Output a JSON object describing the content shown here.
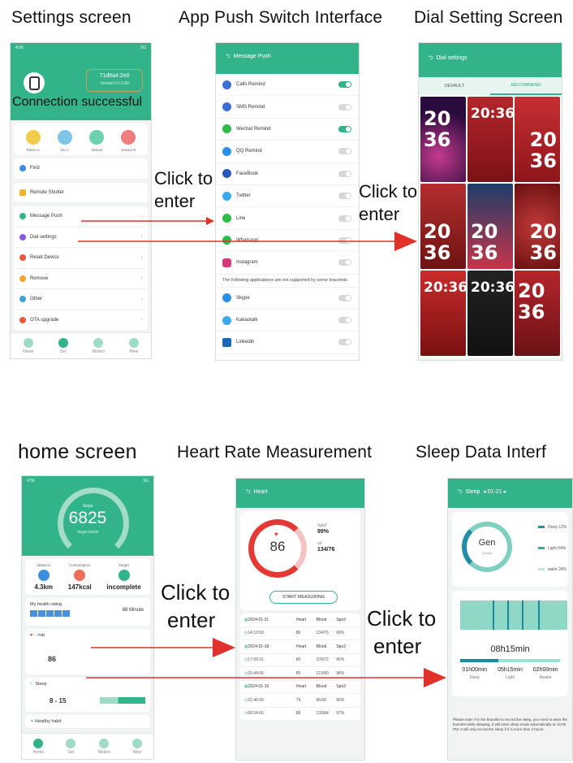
{
  "captions": {
    "settings": "Settings screen",
    "push": "App Push Switch Interface",
    "dial": "Dial Setting Screen",
    "home": "home screen",
    "heart": "Heart Rate Measurement",
    "sleep": "Sleep Data Interf"
  },
  "arrow_labels": {
    "a1_line1": "Click to",
    "a1_line2": "enter",
    "a2_line1": "Click to",
    "a2_line2": "enter",
    "a3_line1": "Click to",
    "a3_line2": "enter",
    "a4_line1": "Click to",
    "a4_line2": "enter"
  },
  "colors": {
    "brand": "#33b389",
    "arrow": "#e0312b",
    "highlight": "#c9a15a"
  },
  "settings_phone": {
    "device_id": "71d6a4:2e0",
    "device_version": "Version:V1.0.60",
    "connection": "Connection successful",
    "quick": [
      "Raise in",
      "Do n",
      "Alarms",
      "ientary R"
    ],
    "menu1": [
      {
        "label": "Find",
        "icon": "search-icon"
      }
    ],
    "menu2": [
      {
        "label": "Remote Shutter",
        "icon": "camera-icon"
      }
    ],
    "menu3": [
      {
        "label": "Message Push",
        "icon": "send-icon"
      },
      {
        "label": "Dial settings",
        "icon": "dial-icon"
      },
      {
        "label": "Reset Device",
        "icon": "reset-icon"
      },
      {
        "label": "Remove",
        "icon": "remove-icon"
      },
      {
        "label": "Other",
        "icon": "other-icon"
      },
      {
        "label": "OTA upgrade",
        "icon": "upgrade-icon"
      }
    ],
    "tabs": [
      "Home",
      "Set",
      "Motion",
      "Mine"
    ]
  },
  "push_phone": {
    "title": "Message Push",
    "items": [
      {
        "label": "Calls Remind",
        "on": true
      },
      {
        "label": "SMS Remind",
        "on": false
      },
      {
        "label": "Wechat Remind",
        "on": true
      },
      {
        "label": "QQ Remind",
        "on": false
      },
      {
        "label": "FaceBook",
        "on": false
      },
      {
        "label": "Twitter",
        "on": false
      },
      {
        "label": "Line",
        "on": false
      },
      {
        "label": "Whatsapp",
        "on": false
      },
      {
        "label": "Instagram",
        "on": false
      }
    ],
    "note": "The following applications are not supported by some bracelets",
    "extra": [
      {
        "label": "Skype",
        "on": false
      },
      {
        "label": "Kakaotalk",
        "on": false
      },
      {
        "label": "Linkedin",
        "on": false
      }
    ]
  },
  "dial_phone": {
    "title": "Dial settings",
    "tab_default": "DEFAULT",
    "tab_recommend": "RECOMMEND",
    "faces": [
      {
        "text": "20\n36"
      },
      {
        "text": "20:36"
      },
      {
        "text": "20\n36"
      },
      {
        "text": "20\n36"
      },
      {
        "text": "20\n36"
      },
      {
        "text": "20\n36"
      },
      {
        "text": "20:36"
      },
      {
        "text": "20:36"
      },
      {
        "text": "20\n36"
      }
    ]
  },
  "home_phone": {
    "steps_label": "Steps",
    "steps": "6825",
    "target": "Target:10000",
    "stats": [
      {
        "label": "distance",
        "value": "4.3km"
      },
      {
        "label": "Consumption",
        "value": "147kcal"
      },
      {
        "label": "Target",
        "value": "incomplete"
      }
    ],
    "rating_label": "My health rating",
    "rating_value": "88 Minute",
    "hr_label": "- -/rat",
    "hr_value": "86",
    "sleep_label": "Sleep",
    "sleep_value": "8 - 15",
    "habit": "Healthy habit",
    "tabs": [
      "Home",
      "Set",
      "Motion",
      "Mine"
    ]
  },
  "heart_phone": {
    "title": "Heart",
    "value": "86",
    "spo2_label": "Spo2",
    "spo2": "99%",
    "bp_label": "od",
    "bp": "134/76",
    "start": "START MEASURING",
    "rows": [
      {
        "a": "2024-01-21",
        "b": "Heart",
        "c": "Blood",
        "d": "Spo2",
        "date": true
      },
      {
        "a": "14:13:50",
        "b": "86",
        "c": "134/76",
        "d": "99%"
      },
      {
        "a": "2024-01-18",
        "b": "Heart",
        "c": "Blood",
        "d": "Spo2",
        "date": true
      },
      {
        "a": "17:09:31",
        "b": "80",
        "c": "109/72",
        "d": "96%"
      },
      {
        "a": "15:44:06",
        "b": "85",
        "c": "123/80",
        "d": "98%"
      },
      {
        "a": "2024-01-16",
        "b": "Heart",
        "c": "Blood",
        "d": "Spo2",
        "date": true
      },
      {
        "a": "21:46:56",
        "b": "79",
        "c": "96/68",
        "d": "96%"
      },
      {
        "a": "06:54:06",
        "b": "88",
        "c": "130/84",
        "d": "97%"
      }
    ]
  },
  "sleep_phone": {
    "title": "Sleep",
    "date": "01-21",
    "quality": "Gen",
    "quality_sub": "Quality",
    "legend": [
      {
        "label": "Deep",
        "pct": "12%",
        "color": "#1f8fa8"
      },
      {
        "label": "Light",
        "pct": "64%",
        "color": "#33b389"
      },
      {
        "label": "wake",
        "pct": "24%",
        "color": "#bde9dd"
      }
    ],
    "total": "08h15min",
    "parts": [
      {
        "value": "01h00min",
        "label": "Deep"
      },
      {
        "value": "05h15min",
        "label": "Light"
      },
      {
        "value": "02h00min",
        "label": "Awake"
      }
    ],
    "note": "Please note: For the bracelet to record the sleep, you need to wear the bracelet while sleeping. It will enter sleep mode automatically at 10:00 PM. It will only record the sleep if it is more than 4 hours."
  }
}
